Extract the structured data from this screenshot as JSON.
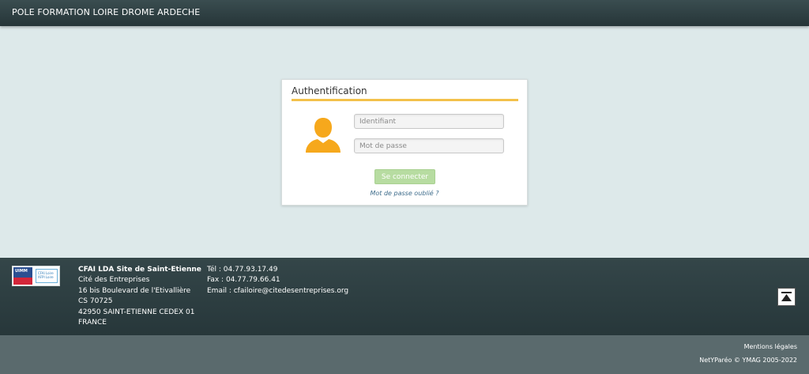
{
  "header": {
    "title": "POLE FORMATION LOIRE DROME ARDECHE"
  },
  "login": {
    "title": "Authentification",
    "username_placeholder": "Identifiant",
    "password_placeholder": "Mot de passe",
    "submit_label": "Se connecter",
    "forgot_label": "Mot de passe oublié ?"
  },
  "footer": {
    "logo": {
      "uimm_text": "UIMM",
      "cfai_text": "CFAI Loire AFPI Loire"
    },
    "address": {
      "name": "CFAI LDA Site de Saint-Etienne",
      "line1": "Cité des Entreprises",
      "line2": "16 bis Boulevard de l'Etivallière",
      "line3": "CS 70725",
      "line4": "42950 SAINT-ETIENNE CEDEX 01",
      "line5": "FRANCE"
    },
    "contact": {
      "tel": "Tél : 04.77.93.17.49",
      "fax": "Fax : 04.77.79.66.41",
      "email": "Email : cfailoire@citedesentreprises.org"
    }
  },
  "bottom": {
    "legal": "Mentions légales",
    "copyright": "NetYParéo © YMAG 2005-2022"
  },
  "colors": {
    "accent": "#f3c14b",
    "button": "#b7dca1",
    "header": "#2d3e41",
    "background": "#dde9ea"
  }
}
